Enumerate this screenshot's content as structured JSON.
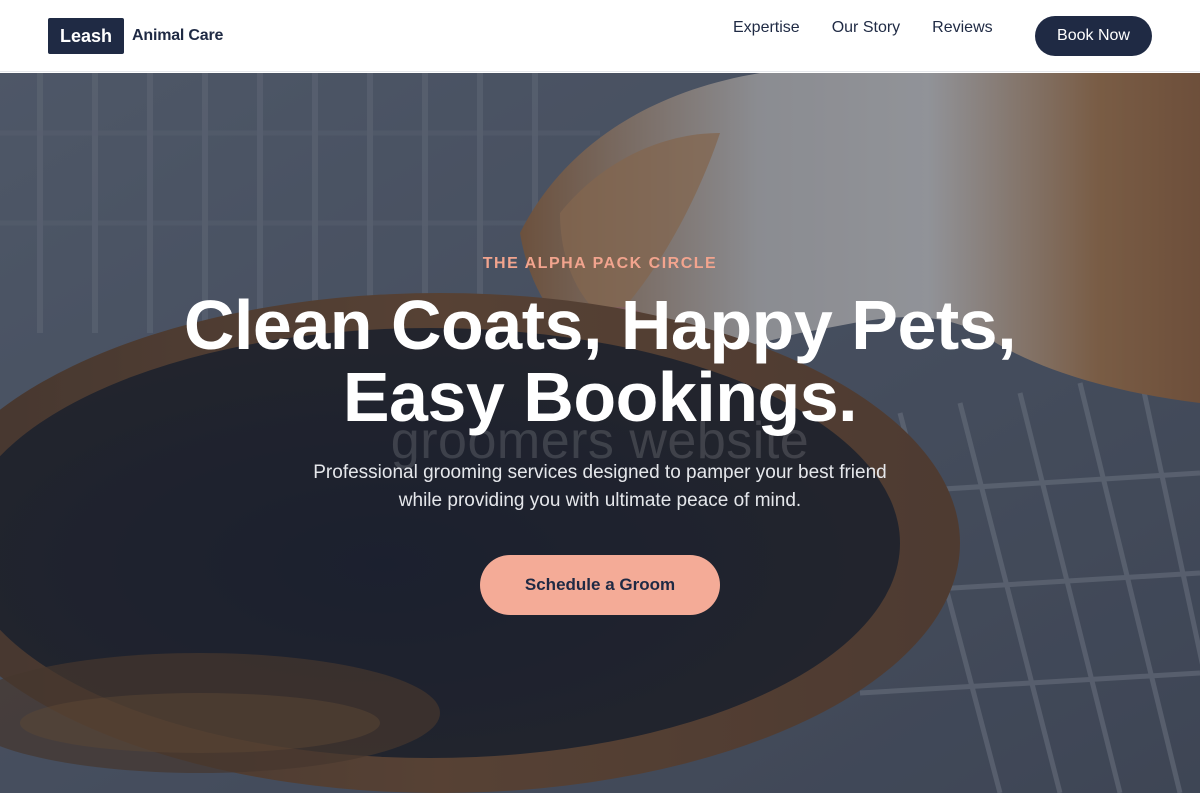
{
  "brand": {
    "badge": "Leash",
    "name": "Animal Care"
  },
  "nav": {
    "links": [
      "Expertise",
      "Our Story",
      "Reviews"
    ],
    "cta": "Book Now"
  },
  "hero": {
    "eyebrow": "THE ALPHA PACK CIRCLE",
    "headline_line1": "Clean Coats, Happy Pets,",
    "headline_line2": "Easy Bookings.",
    "watermark": "groomers website",
    "subtitle_line1": "Professional grooming services designed to pamper your best friend",
    "subtitle_line2": "while providing you with ultimate peace of mind.",
    "cta": "Schedule a Groom",
    "background_image": "hamster drinking from a bowl"
  },
  "colors": {
    "navy": "#1f2a44",
    "accent": "#f4ab97",
    "eyebrow": "#f2a48e",
    "white": "#ffffff"
  }
}
